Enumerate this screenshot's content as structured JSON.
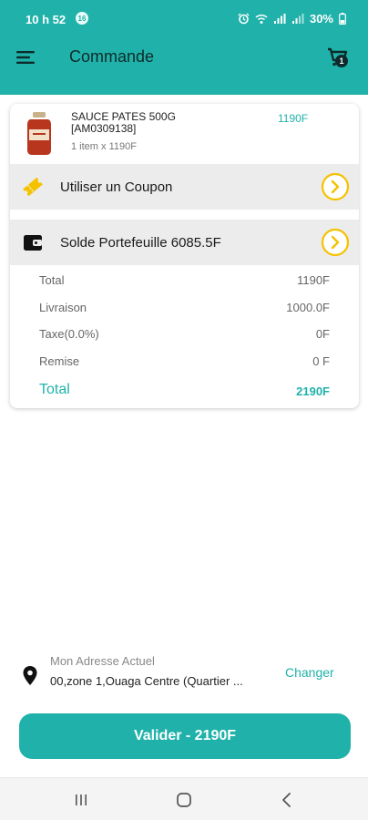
{
  "status_bar": {
    "time": "10 h 52",
    "notification_badge": "16",
    "battery": "30%"
  },
  "header": {
    "title": "Commande",
    "cart_count": "1"
  },
  "order_item": {
    "name": "SAUCE PATES 500G [AM0309138]",
    "quantity_text": "1 item x 1190F",
    "price": "1190F"
  },
  "coupon": {
    "label": "Utiliser un Coupon",
    "icon": "ticket-icon"
  },
  "wallet": {
    "label": "Solde Portefeuille 6085.5F",
    "icon": "wallet-icon"
  },
  "summary": {
    "rows": [
      {
        "label": "Total",
        "value": "1190F"
      },
      {
        "label": "Livraison",
        "value": "1000.0F"
      },
      {
        "label": "Taxe(0.0%)",
        "value": "0F"
      },
      {
        "label": "Remise",
        "value": "0 F"
      }
    ],
    "grand_total": {
      "label": "Total",
      "value": "2190F"
    }
  },
  "address": {
    "label": "Mon Adresse Actuel",
    "value": "00,zone 1,Ouaga Centre (Quartier ...",
    "change_label": "Changer"
  },
  "validate_button": {
    "label": "Valider - 2190F"
  },
  "colors": {
    "primary": "#20b2aa",
    "arrow_accent": "#f5c200",
    "row_background": "#ececec"
  }
}
